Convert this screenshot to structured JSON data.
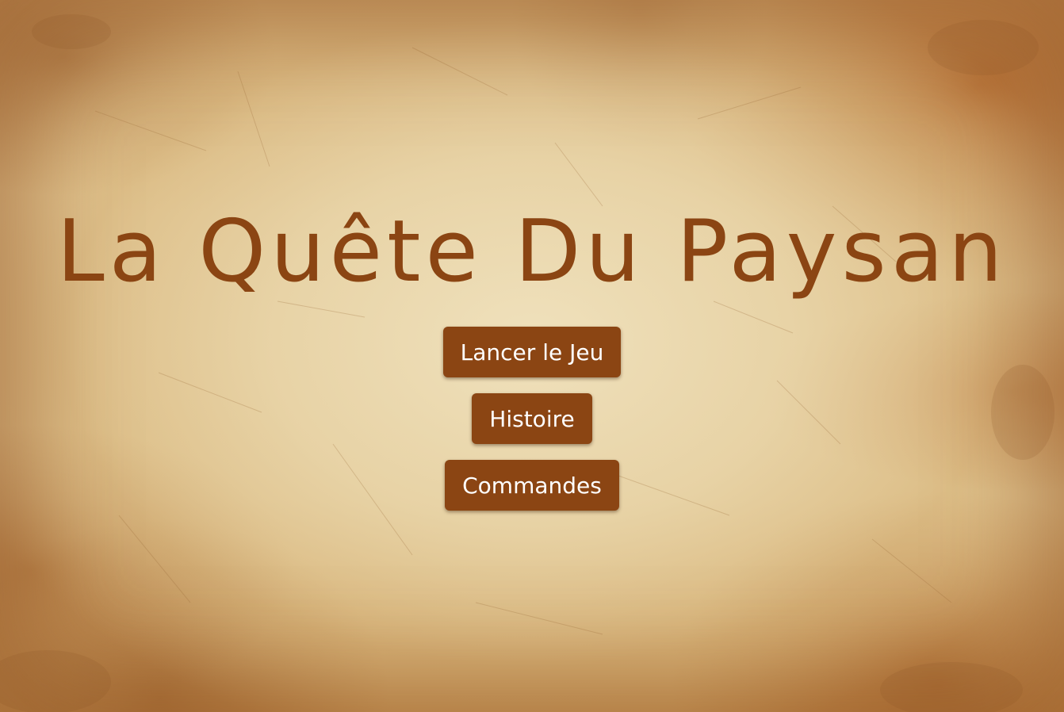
{
  "title": "La Quête Du Paysan",
  "menu": {
    "start_label": "Lancer le Jeu",
    "story_label": "Histoire",
    "controls_label": "Commandes"
  },
  "colors": {
    "accent": "#8b4513",
    "button_text": "#ffffff",
    "parchment": "#e4c994"
  }
}
